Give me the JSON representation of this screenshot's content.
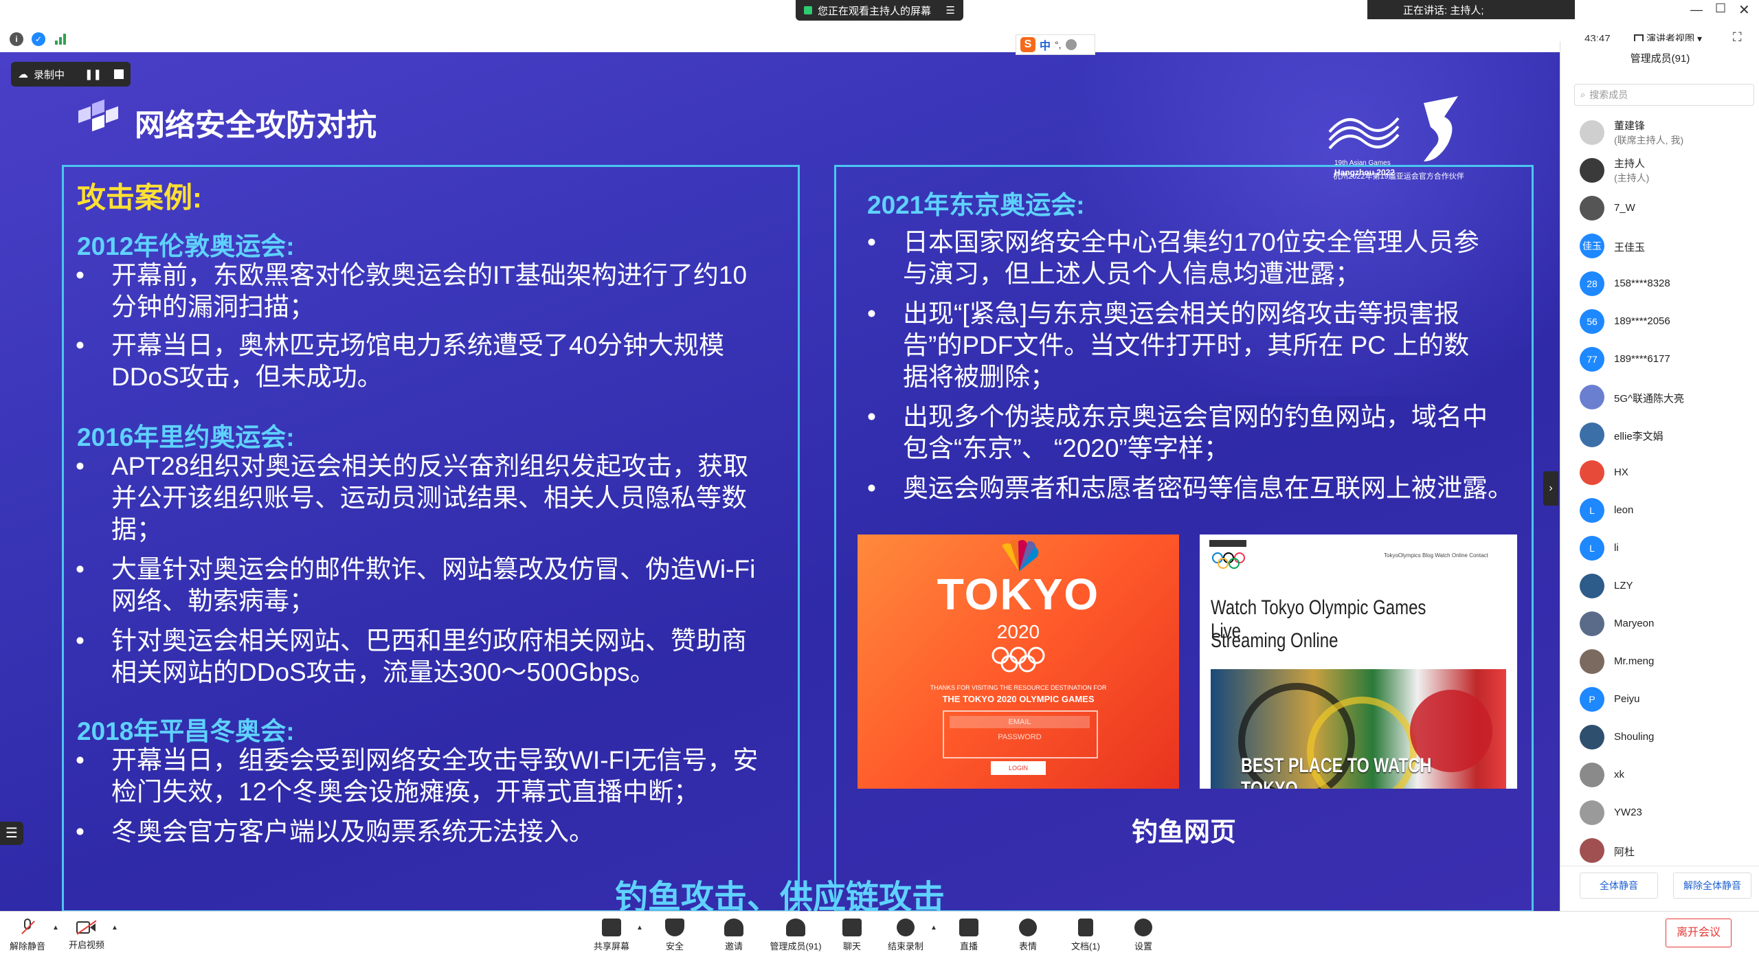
{
  "top": {
    "share_notice": "您正在观看主持人的屏幕",
    "speaking": "正在讲话: 主持人;",
    "timer": "43:47",
    "view_mode": "演讲者视图",
    "ime": "中"
  },
  "recording": {
    "label": "录制中"
  },
  "slide": {
    "title": "网络安全攻防对抗",
    "logo_caption_1": "19th Asian Games",
    "logo_caption_2": "Hangzhou 2022",
    "logo_caption_3": "杭州2022年第19届亚运会官方合作伙伴",
    "left": {
      "heading": "攻击案例:",
      "sections": [
        {
          "title": "2012年伦敦奥运会:",
          "bullets": [
            [
              "开幕前，东欧黑客对伦敦奥运会的IT基础架构进行了约10",
              "分钟的漏洞扫描；"
            ],
            [
              "开幕当日，奥林匹克场馆电力系统遭受了40分钟大规模",
              "DDoS攻击，但未成功。"
            ]
          ]
        },
        {
          "title": "2016年里约奥运会:",
          "bullets": [
            [
              "APT28组织对奥运会相关的反兴奋剂组织发起攻击，获取",
              "并公开该组织账号、运动员测试结果、相关人员隐私等数",
              "据；"
            ],
            [
              "大量针对奥运会的邮件欺诈、网站篡改及仿冒、伪造Wi-Fi",
              "网络、勒索病毒；"
            ],
            [
              "针对奥运会相关网站、巴西和里约政府相关网站、赞助商",
              "相关网站的DDoS攻击，流量达300～500Gbps。"
            ]
          ]
        },
        {
          "title": "2018年平昌冬奥会:",
          "bullets": [
            [
              "开幕当日，组委会受到网络安全攻击导致WI-FI无信号，安",
              "检门失效，12个冬奥会设施瘫痪，开幕式直播中断；"
            ],
            [
              "冬奥会官方客户端以及购票系统无法接入。"
            ]
          ]
        }
      ]
    },
    "right": {
      "title": "2021年东京奥运会:",
      "bullets": [
        [
          "日本国家网络安全中心召集约170位安全管理人员参",
          "与演习，但上述人员个人信息均遭泄露；"
        ],
        [
          "出现“[紧急]与东京奥运会相关的网络攻击等损害报",
          "告”的PDF文件。当文件打开时，其所在 PC 上的数",
          "据将被删除；"
        ],
        [
          "出现多个伪装成东京奥运会官网的钓鱼网站，域名中",
          "包含“东京”、 “2020”等字样；"
        ],
        [
          "奥运会购票者和志愿者密码等信息在互联网上被泄露。"
        ]
      ],
      "img1": {
        "brand": "TOKYO",
        "year": "2020",
        "thanks": "THANKS FOR VISITING THE RESOURCE DESTINATION FOR",
        "games": "THE TOKYO 2020 OLYMPIC GAMES",
        "email": "EMAIL",
        "password": "PASSWORD",
        "login": "LOGIN"
      },
      "img2": {
        "nav": "TokyoOlympics  Blog  Watch Online  Contact",
        "line1": "Watch Tokyo Olympic Games Live",
        "line2": "Streaming Online",
        "banner": "BEST PLACE TO WATCH TOKYO"
      },
      "caption": "钓鱼网页"
    },
    "footer": "钓鱼攻击、供应链攻击"
  },
  "members_panel": {
    "header": "管理成员(91)",
    "search_placeholder": "搜索成员",
    "members": [
      {
        "name": "董建锋",
        "sub": "(联席主持人, 我)",
        "avatar_text": "",
        "color": "#cfcfcf"
      },
      {
        "name": "主持人",
        "sub": "(主持人)",
        "avatar_text": "",
        "color": "#3a3a3a"
      },
      {
        "name": "7_W",
        "sub": "",
        "avatar_text": "",
        "color": "#555555"
      },
      {
        "name": "王佳玉",
        "sub": "",
        "avatar_text": "佳玉",
        "color": "#1e88ff"
      },
      {
        "name": "158****8328",
        "sub": "",
        "avatar_text": "28",
        "color": "#1e88ff"
      },
      {
        "name": "189****2056",
        "sub": "",
        "avatar_text": "56",
        "color": "#1e88ff"
      },
      {
        "name": "189****6177",
        "sub": "",
        "avatar_text": "77",
        "color": "#1e88ff"
      },
      {
        "name": "5G^联通陈大亮",
        "sub": "",
        "avatar_text": "",
        "color": "#6a7fd0"
      },
      {
        "name": "ellie李文娟",
        "sub": "",
        "avatar_text": "",
        "color": "#3b6fa8"
      },
      {
        "name": "HX",
        "sub": "",
        "avatar_text": "",
        "color": "#e84a3a"
      },
      {
        "name": "leon",
        "sub": "",
        "avatar_text": "L",
        "color": "#1e88ff"
      },
      {
        "name": "li",
        "sub": "",
        "avatar_text": "L",
        "color": "#1e88ff"
      },
      {
        "name": "LZY",
        "sub": "",
        "avatar_text": "",
        "color": "#2d5b8a"
      },
      {
        "name": "Maryeon",
        "sub": "",
        "avatar_text": "",
        "color": "#5a6b8a"
      },
      {
        "name": "Mr.meng",
        "sub": "",
        "avatar_text": "",
        "color": "#7a6a60"
      },
      {
        "name": "Peiyu",
        "sub": "",
        "avatar_text": "P",
        "color": "#1e88ff"
      },
      {
        "name": "Shouling",
        "sub": "",
        "avatar_text": "",
        "color": "#2f4f6f"
      },
      {
        "name": "xk",
        "sub": "",
        "avatar_text": "",
        "color": "#8a8a8a"
      },
      {
        "name": "YW23",
        "sub": "",
        "avatar_text": "",
        "color": "#9a9a9a"
      },
      {
        "name": "阿杜",
        "sub": "",
        "avatar_text": "",
        "color": "#a05050"
      }
    ],
    "mute_all": "全体静音",
    "unmute_all": "解除全体静音"
  },
  "toolbar": {
    "unmute": "解除静音",
    "video": "开启视频",
    "share": "共享屏幕",
    "security": "安全",
    "invite": "邀请",
    "members": "管理成员(91)",
    "chat": "聊天",
    "end_record": "结束录制",
    "live": "直播",
    "emoji": "表情",
    "docs": "文档(1)",
    "settings": "设置",
    "leave": "离开会议"
  },
  "colors": {
    "panel_border": "#4dc6f0",
    "heading_yellow": "#ffe033",
    "section_cyan": "#5fd2ff",
    "leave_red": "#e53935"
  }
}
